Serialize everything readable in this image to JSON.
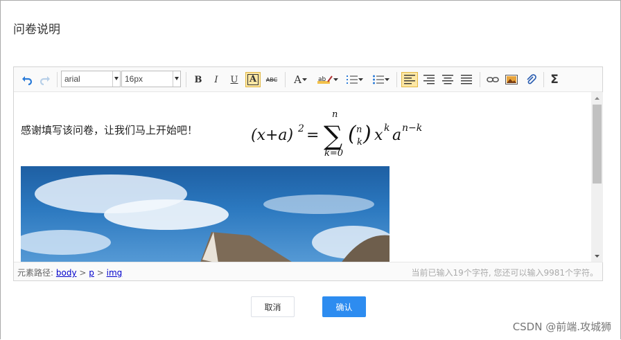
{
  "dialog": {
    "title": "问卷说明"
  },
  "toolbar": {
    "font_family": "arial",
    "font_size": "16px",
    "bold": "B",
    "italic": "I",
    "underline": "U",
    "font_border": "A",
    "strike": "ABC",
    "fore_color": "A",
    "sigma": "Σ"
  },
  "content": {
    "greeting": "感谢填写该问卷，让我们马上开始吧！",
    "formula": {
      "lhs": "(x+a)",
      "exp": "2",
      "eq": "=",
      "sum": "∑",
      "upper": "n",
      "lower": "k=0",
      "binom_top": "n",
      "binom_bottom": "k",
      "x": "x",
      "x_exp": "k",
      "a": "a",
      "a_exp": "n−k"
    }
  },
  "status": {
    "path_label": "元素路径:",
    "path_items": [
      "body",
      "p",
      "img"
    ],
    "path_sep": ">",
    "count_text": "当前已输入19个字符, 您还可以输入9981个字符。"
  },
  "buttons": {
    "cancel": "取消",
    "ok": "确认"
  },
  "watermark": "CSDN @前端.攻城狮",
  "colors": {
    "primary": "#2d8cf0",
    "active_tool": "#fde7a4"
  }
}
